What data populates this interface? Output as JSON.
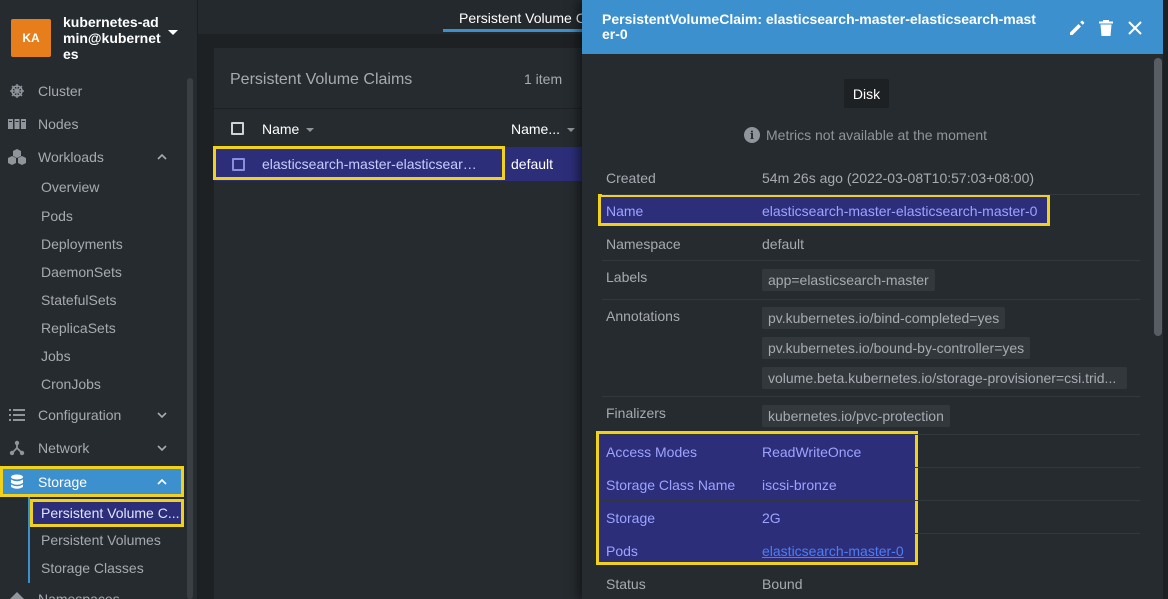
{
  "context": {
    "avatar": "KA",
    "name": "kubernetes-admin@kubernetes"
  },
  "sidebar": {
    "items": [
      {
        "label": "Cluster",
        "icon": "helm-wheel-icon"
      },
      {
        "label": "Nodes",
        "icon": "nodes-icon"
      },
      {
        "label": "Workloads",
        "icon": "workloads-icon",
        "expanded": true
      },
      {
        "label": "Configuration",
        "icon": "list-icon"
      },
      {
        "label": "Network",
        "icon": "network-icon"
      },
      {
        "label": "Storage",
        "icon": "database-icon",
        "expanded": true,
        "active": true
      },
      {
        "label": "Namespaces",
        "icon": "namespace-icon"
      }
    ],
    "workloads_sub": [
      "Overview",
      "Pods",
      "Deployments",
      "DaemonSets",
      "StatefulSets",
      "ReplicaSets",
      "Jobs",
      "CronJobs"
    ],
    "storage_sub": [
      "Persistent Volume C...",
      "Persistent Volumes",
      "Storage Classes"
    ]
  },
  "tab": {
    "label": "Persistent Volume Claims"
  },
  "list": {
    "title": "Persistent Volume Claims",
    "count": "1 item",
    "columns": [
      "Name",
      "Name..."
    ],
    "rows": [
      {
        "name": "elasticsearch-master-elasticsearch-master-0",
        "namespace": "default"
      }
    ]
  },
  "drawer": {
    "title": "PersistentVolumeClaim: elasticsearch-master-elasticsearch-master-0",
    "disk_button": "Disk",
    "metrics_note": "Metrics not available at the moment",
    "fields": {
      "created_label": "Created",
      "created_value": "54m 26s ago (2022-03-08T10:57:03+08:00)",
      "name_label": "Name",
      "name_value": "elasticsearch-master-elasticsearch-master-0",
      "namespace_label": "Namespace",
      "namespace_value": "default",
      "labels_label": "Labels",
      "labels": [
        "app=elasticsearch-master"
      ],
      "annotations_label": "Annotations",
      "annotations": [
        "pv.kubernetes.io/bind-completed=yes",
        "pv.kubernetes.io/bound-by-controller=yes",
        "volume.beta.kubernetes.io/storage-provisioner=csi.trid..."
      ],
      "finalizers_label": "Finalizers",
      "finalizers": [
        "kubernetes.io/pvc-protection"
      ],
      "access_modes_label": "Access Modes",
      "access_modes_value": "ReadWriteOnce",
      "storage_class_label": "Storage Class Name",
      "storage_class_value": "iscsi-bronze",
      "storage_label": "Storage",
      "storage_value": "2G",
      "pods_label": "Pods",
      "pods_value": "elasticsearch-master-0",
      "status_label": "Status",
      "status_value": "Bound"
    }
  },
  "colors": {
    "accent": "#3d90ce",
    "highlight": "#f0d21d",
    "selected": "#2c2e7a",
    "avatar": "#e67e1c"
  }
}
